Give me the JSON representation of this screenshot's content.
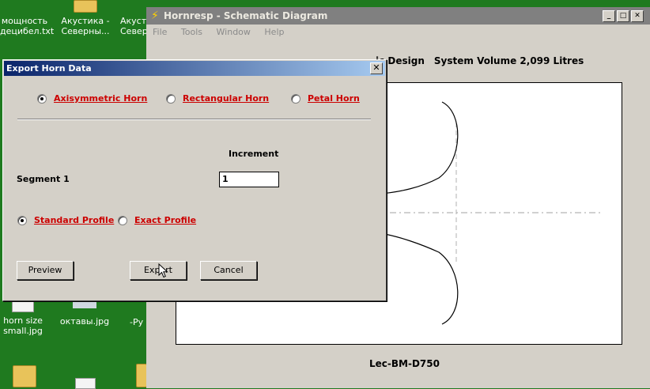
{
  "desktop": {
    "icons": [
      {
        "label_line1": "мощность",
        "label_line2": "децибел.txt"
      },
      {
        "label_line1": "Акустика -",
        "label_line2": "Северны..."
      },
      {
        "label_line1": "Акуст",
        "label_line2": "Север"
      },
      {
        "label_line1": "horn size",
        "label_line2": "small.jpg"
      },
      {
        "label_line1": "октавы.jpg",
        "label_line2": ""
      },
      {
        "label_line1": "-Ру",
        "label_line2": ""
      }
    ]
  },
  "main_window": {
    "title": "Hornresp - Schematic Diagram",
    "menu": [
      "File",
      "Tools",
      "Window",
      "Help"
    ],
    "design_text": "ic Design",
    "system_volume": "System Volume 2,099 Litres",
    "footer_label": "Lec-BM-D750"
  },
  "dialog": {
    "title": "Export Horn Data",
    "close_glyph": "✕",
    "horn_types": [
      {
        "label": "Axisymmetric Horn",
        "selected": true
      },
      {
        "label": "Rectangular Horn",
        "selected": false
      },
      {
        "label": "Petal Horn",
        "selected": false
      }
    ],
    "increment_header": "Increment",
    "segment_label": "Segment 1",
    "increment_value": "1",
    "profiles": [
      {
        "label": "Standard Profile",
        "selected": true
      },
      {
        "label": "Exact Profile",
        "selected": false
      }
    ],
    "buttons": {
      "preview": "Preview",
      "export": "Export",
      "cancel": "Cancel"
    }
  },
  "colors": {
    "desktop": "#1f7a1f",
    "dialog_title_start": "#0a246a",
    "dialog_title_end": "#a6caf0",
    "radio_label": "#cc0000"
  }
}
